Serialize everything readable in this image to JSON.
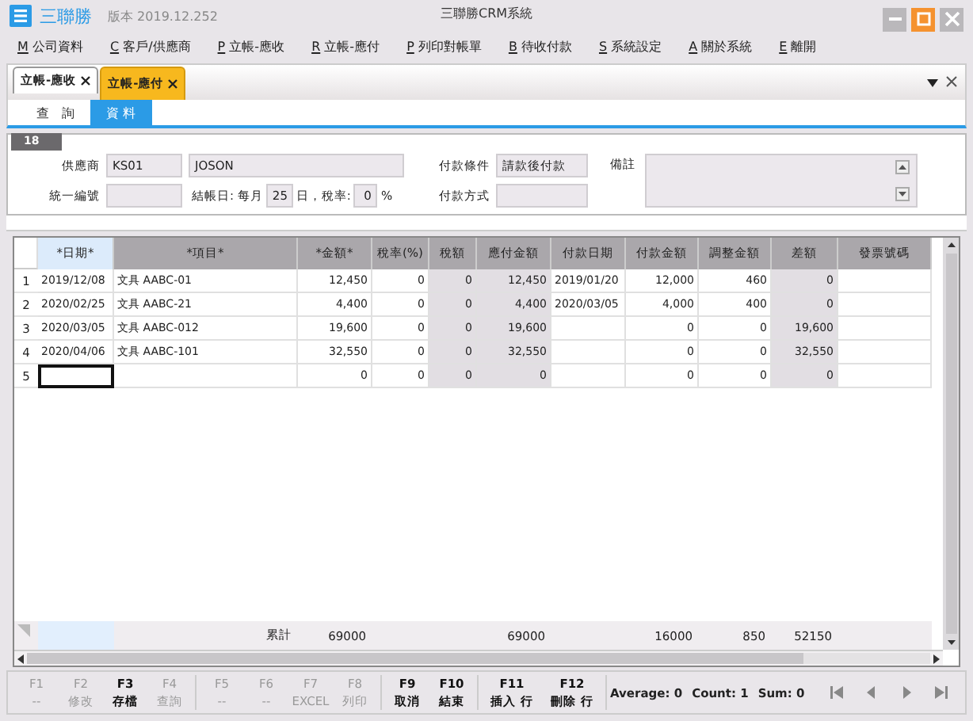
{
  "window": {
    "app_name": "三聯勝",
    "version": "版本 2019.12.252",
    "title": "三聯勝CRM系統"
  },
  "menu": [
    {
      "key": "M",
      "label": "公司資料"
    },
    {
      "key": "C",
      "label": "客戶/供應商"
    },
    {
      "key": "P",
      "label": "立帳-應收"
    },
    {
      "key": "R",
      "label": "立帳-應付"
    },
    {
      "key": "P",
      "label": "列印對帳單"
    },
    {
      "key": "B",
      "label": "待收付款"
    },
    {
      "key": "S",
      "label": "系統設定"
    },
    {
      "key": "A",
      "label": "關於系統"
    },
    {
      "key": "E",
      "label": "離開"
    }
  ],
  "doc_tabs": [
    {
      "label": "立帳-應收",
      "selected": false
    },
    {
      "label": "立帳-應付",
      "selected": true
    }
  ],
  "sub_tabs": [
    {
      "label": "查　詢",
      "selected": false
    },
    {
      "label": "資 料",
      "selected": true
    }
  ],
  "record_badge": "18",
  "form": {
    "supplier": {
      "label": "供應商",
      "code": "KS01",
      "name": "JOSON"
    },
    "tax_id": {
      "label": "統一編號"
    },
    "closing": {
      "label": "結帳日: 每月",
      "day": "25",
      "day_unit": "日，稅率:",
      "tax_rate": "0",
      "percent": "%"
    },
    "payment_terms": {
      "label": "付款條件",
      "value": "請款後付款"
    },
    "payment_method": {
      "label": "付款方式"
    },
    "note": {
      "label": "備註"
    }
  },
  "table": {
    "columns": [
      {
        "label": "*日期*",
        "kind": "date",
        "readonly": false,
        "selected": true
      },
      {
        "label": "*項目*",
        "kind": "text",
        "readonly": false,
        "selected": false
      },
      {
        "label": "*金額*",
        "kind": "amount",
        "readonly": false,
        "selected": false
      },
      {
        "label": "稅率(%)",
        "kind": "amount",
        "readonly": false,
        "selected": false
      },
      {
        "label": "稅額",
        "kind": "amount",
        "readonly": true,
        "selected": false
      },
      {
        "label": "應付金額",
        "kind": "amount",
        "readonly": true,
        "selected": false
      },
      {
        "label": "付款日期",
        "kind": "date",
        "readonly": false,
        "selected": false
      },
      {
        "label": "付款金額",
        "kind": "amount",
        "readonly": false,
        "selected": false
      },
      {
        "label": "調整金額",
        "kind": "amount",
        "readonly": false,
        "selected": false
      },
      {
        "label": "差額",
        "kind": "amount",
        "readonly": true,
        "selected": false
      },
      {
        "label": "發票號碼",
        "kind": "text",
        "readonly": false,
        "selected": false
      }
    ],
    "rows": [
      {
        "number": "1",
        "focused": false,
        "cells": [
          "2019/12/08",
          "文具 AABC-01",
          "12,450",
          "0",
          "0",
          "12,450",
          "2019/01/20",
          "12,000",
          "460",
          "0",
          ""
        ]
      },
      {
        "number": "2",
        "focused": false,
        "cells": [
          "2020/02/25",
          "文具 AABC-21",
          "4,400",
          "0",
          "0",
          "4,400",
          "2020/03/05",
          "4,000",
          "400",
          "0",
          ""
        ]
      },
      {
        "number": "3",
        "focused": false,
        "cells": [
          "2020/03/05",
          "文具 AABC-012",
          "19,600",
          "0",
          "0",
          "19,600",
          "",
          "0",
          "0",
          "19,600",
          ""
        ]
      },
      {
        "number": "4",
        "focused": false,
        "cells": [
          "2020/04/06",
          "文具 AABC-101",
          "32,550",
          "0",
          "0",
          "32,550",
          "",
          "0",
          "0",
          "32,550",
          ""
        ]
      },
      {
        "number": "5",
        "focused": true,
        "cells": [
          "",
          "",
          "0",
          "0",
          "0",
          "0",
          "",
          "0",
          "0",
          "0",
          ""
        ]
      }
    ],
    "totals": {
      "cells": [
        "",
        "累計",
        "69000",
        "",
        "",
        "69000",
        "",
        "16000",
        "850",
        "52150",
        ""
      ]
    }
  },
  "function_keys": [
    {
      "key": "F1",
      "label": "--",
      "disabled": true
    },
    {
      "key": "F2",
      "label": "修改",
      "disabled": true
    },
    {
      "key": "F3",
      "label": "存檔",
      "disabled": false
    },
    {
      "key": "F4",
      "label": "查詢",
      "disabled": true
    },
    {
      "key": "F5",
      "label": "--",
      "disabled": true
    },
    {
      "key": "F6",
      "label": "--",
      "disabled": true
    },
    {
      "key": "F7",
      "label": "EXCEL",
      "disabled": true
    },
    {
      "key": "F8",
      "label": "列印",
      "disabled": true
    },
    {
      "key": "F9",
      "label": "取消",
      "disabled": false
    },
    {
      "key": "F10",
      "label": "結束",
      "disabled": false
    },
    {
      "key": "F11",
      "label": "插入 行",
      "disabled": false
    },
    {
      "key": "F12",
      "label": "刪除 行",
      "disabled": false
    }
  ],
  "status": [
    "Average: 0",
    "Count: 1",
    "Sum: 0"
  ]
}
